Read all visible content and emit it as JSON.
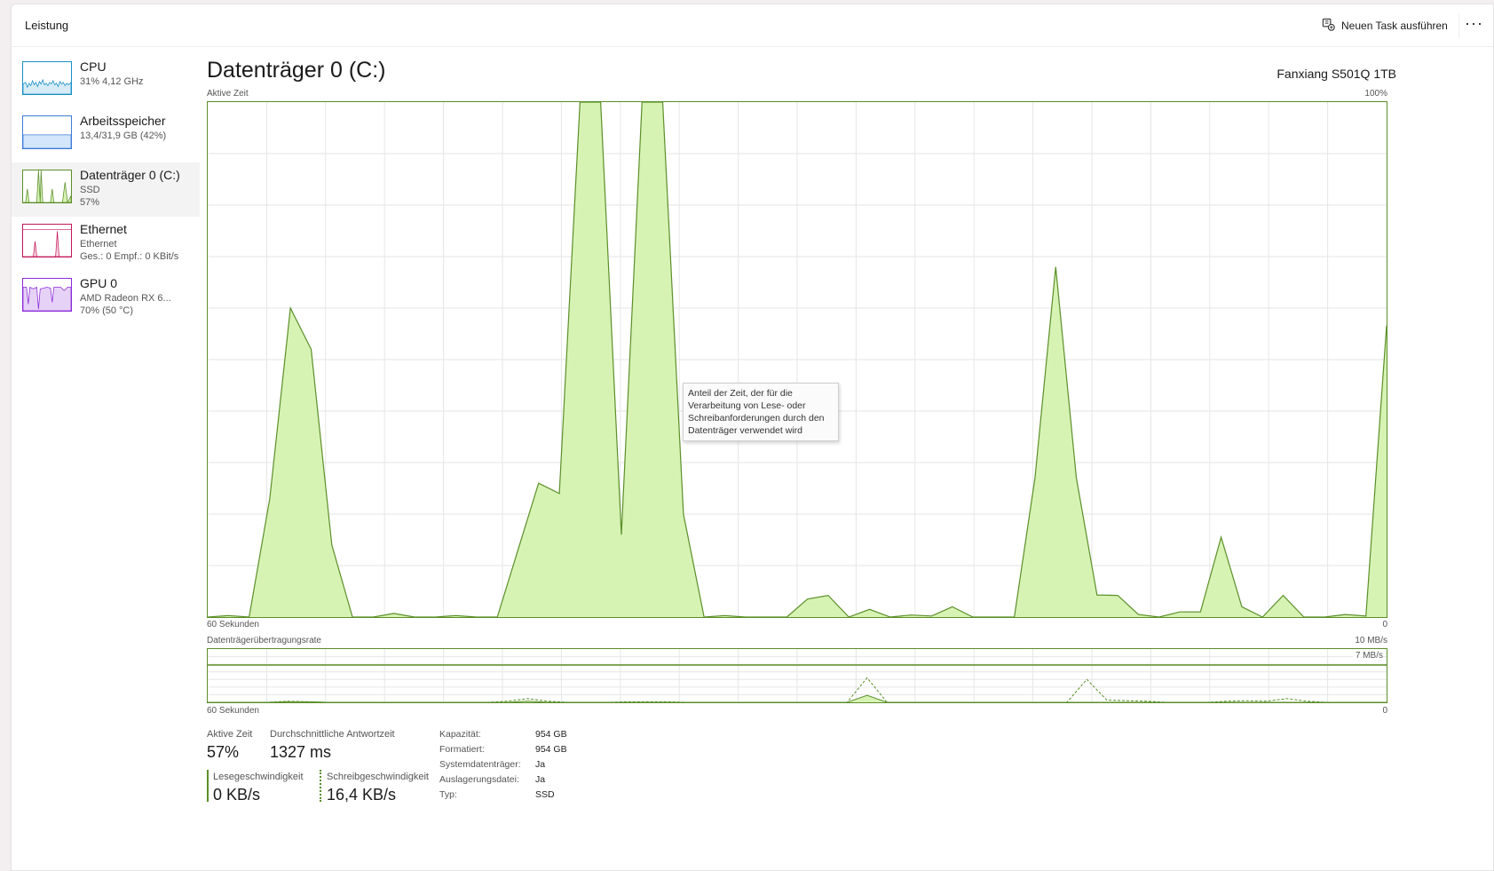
{
  "app": {
    "section_title": "Leistung",
    "run_task_label": "Neuen Task ausführen",
    "more_label": "···",
    "accent_color": "#5b8f29",
    "fill_color": "#d7f3b4"
  },
  "sidebar": {
    "items": [
      {
        "name": "CPU",
        "line1": "31% 4,12 GHz",
        "line2": "",
        "color": "#1a8fc7",
        "fill": "#d7ecf7"
      },
      {
        "name": "Arbeitsspeicher",
        "line1": "13,4/31,9 GB (42%)",
        "line2": "",
        "color": "#3d7bd9",
        "fill": "#d4e6fb"
      },
      {
        "name": "Datenträger 0 (C:)",
        "line1": "SSD",
        "line2": "57%",
        "color": "#5b8f29",
        "fill": "#d7f3b4"
      },
      {
        "name": "Ethernet",
        "line1": "Ethernet",
        "line2": "Ges.: 0 Empf.: 0 KBit/s",
        "color": "#c4195a",
        "fill": "#f7dbe5"
      },
      {
        "name": "GPU 0",
        "line1": "AMD Radeon RX 6...",
        "line2": "70% (50 °C)",
        "color": "#8a2bd9",
        "fill": "#e7d2f7"
      }
    ]
  },
  "main": {
    "title": "Datenträger 0 (C:)",
    "device": "Fanxiang S501Q 1TB",
    "chart1_label": "Aktive Zeit",
    "chart1_max": "100%",
    "chart1_left_axis": "60 Sekunden",
    "chart1_right_axis": "0",
    "chart2_label": "Datenträgerübertragungsrate",
    "chart2_max": "10 MB/s",
    "chart2_scale": "7 MB/s",
    "chart2_left_axis": "60 Sekunden",
    "chart2_right_axis": "0",
    "tooltip": "Anteil der Zeit, der für die Verarbeitung von Lese- oder Schreibanforderungen durch den Datenträger verwendet wird"
  },
  "chart_data": {
    "type": "area",
    "active_time_percent": [
      0,
      0.3,
      0,
      23,
      60,
      52,
      14,
      0,
      0,
      0.7,
      0,
      0,
      0.3,
      0,
      0,
      13,
      26,
      24,
      100,
      100,
      16,
      100,
      100,
      20,
      0,
      0.3,
      0,
      0,
      0,
      3.5,
      4.2,
      0,
      1.5,
      0,
      0.4,
      0.2,
      2,
      0,
      0,
      0,
      27,
      68,
      27,
      4.3,
      4.2,
      0.5,
      0,
      1,
      1,
      15.5,
      2,
      0,
      4.2,
      0,
      0,
      0.5,
      0.2,
      56.6
    ],
    "transfer_rate_read_mb_s": [
      0,
      0,
      0,
      0,
      0.1,
      0.1,
      0,
      0,
      0,
      0,
      0,
      0,
      0,
      0,
      0,
      0,
      0.2,
      0,
      0,
      0,
      0,
      0,
      0,
      0,
      0,
      0,
      0,
      0,
      0,
      0,
      0,
      0,
      0,
      1.3,
      0,
      0,
      0,
      0,
      0,
      0,
      0,
      0,
      0,
      0,
      0,
      0,
      0,
      0,
      0,
      0,
      0,
      0,
      0,
      0,
      0,
      0,
      0,
      0,
      0,
      0
    ],
    "transfer_rate_write_mb_s": [
      0,
      0,
      0,
      0,
      0.2,
      0.1,
      0,
      0,
      0,
      0,
      0,
      0,
      0,
      0,
      0,
      0.2,
      0.7,
      0.2,
      0,
      0,
      0,
      0.1,
      0.1,
      0.1,
      0,
      0,
      0,
      0,
      0,
      0,
      0,
      0,
      0,
      4.6,
      0,
      0,
      0,
      0,
      0,
      0,
      0,
      0,
      0,
      0,
      4.3,
      0.4,
      0.3,
      0.2,
      0,
      0,
      0,
      0.2,
      0.3,
      0.2,
      0.7,
      0.2,
      0,
      0,
      0,
      0
    ],
    "ymax_active": 100,
    "ymax_rate": 10,
    "rate_reference_line": 7
  },
  "stats": {
    "active_time_label": "Aktive Zeit",
    "active_time_value": "57%",
    "response_label": "Durchschnittliche Antwortzeit",
    "response_value": "1327 ms",
    "read_label": "Lesegeschwindigkeit",
    "read_value": "0 KB/s",
    "write_label": "Schreibgeschwindigkeit",
    "write_value": "16,4 KB/s"
  },
  "info": [
    {
      "key": "Kapazität:",
      "value": "954 GB"
    },
    {
      "key": "Formatiert:",
      "value": "954 GB"
    },
    {
      "key": "Systemdatenträger:",
      "value": "Ja"
    },
    {
      "key": "Auslagerungsdatei:",
      "value": "Ja"
    },
    {
      "key": "Typ:",
      "value": "SSD"
    }
  ]
}
